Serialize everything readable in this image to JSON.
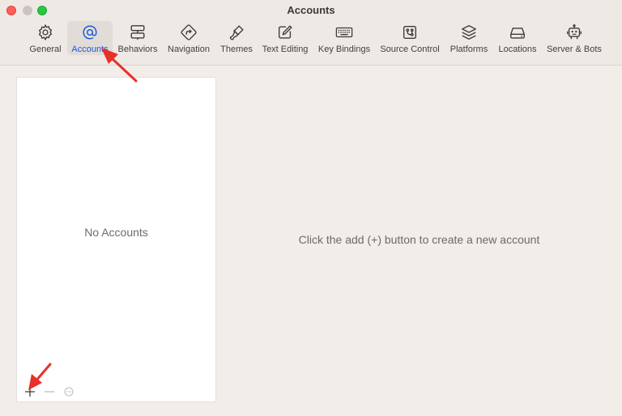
{
  "window": {
    "title": "Accounts"
  },
  "toolbar": {
    "items": [
      {
        "label": "General",
        "icon": "gear-icon"
      },
      {
        "label": "Accounts",
        "icon": "at-sign-icon",
        "active": true
      },
      {
        "label": "Behaviors",
        "icon": "behaviors-icon"
      },
      {
        "label": "Navigation",
        "icon": "navigation-icon"
      },
      {
        "label": "Themes",
        "icon": "brush-icon"
      },
      {
        "label": "Text Editing",
        "icon": "pencil-square-icon"
      },
      {
        "label": "Key Bindings",
        "icon": "keyboard-icon"
      },
      {
        "label": "Source Control",
        "icon": "source-control-icon"
      },
      {
        "label": "Platforms",
        "icon": "layers-icon"
      },
      {
        "label": "Locations",
        "icon": "drive-icon"
      },
      {
        "label": "Server & Bots",
        "icon": "robot-icon"
      }
    ]
  },
  "accounts_panel": {
    "empty_text": "No Accounts"
  },
  "detail": {
    "hint": "Click the add (+) button to create a new account"
  },
  "colors": {
    "accent": "#1a5ad7",
    "annotation_arrow": "#e8302a"
  }
}
